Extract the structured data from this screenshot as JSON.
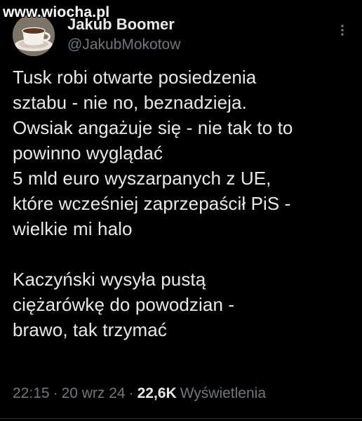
{
  "watermark": {
    "text": "www.wiocha.pl"
  },
  "author": {
    "display_name": "Jakub Boomer",
    "handle": "@JakubMokotow",
    "avatar_icon": "coffee-cup-avatar-icon"
  },
  "tweet": {
    "text": "Tusk robi otwarte posiedzenia\nsztabu - nie no, beznadzieja.\nOwsiak angażuje się - nie tak to to\npowinno wyglądać\n5 mld euro wyszarpanych z UE,\nktóre wcześniej zaprzepaścił PiS -\nwielkie mi halo\n\nKaczyński wysyła pustą\nciężarówkę do powodzian -\nbrawo, tak trzymać"
  },
  "meta": {
    "time": "22:15",
    "separator": "·",
    "date": "20 wrz 24",
    "views_count": "22,6K",
    "views_label": "Wyświetlenia"
  },
  "colors": {
    "background": "#000000",
    "primary_text": "#e7e9ea",
    "secondary_text": "#71767b"
  }
}
